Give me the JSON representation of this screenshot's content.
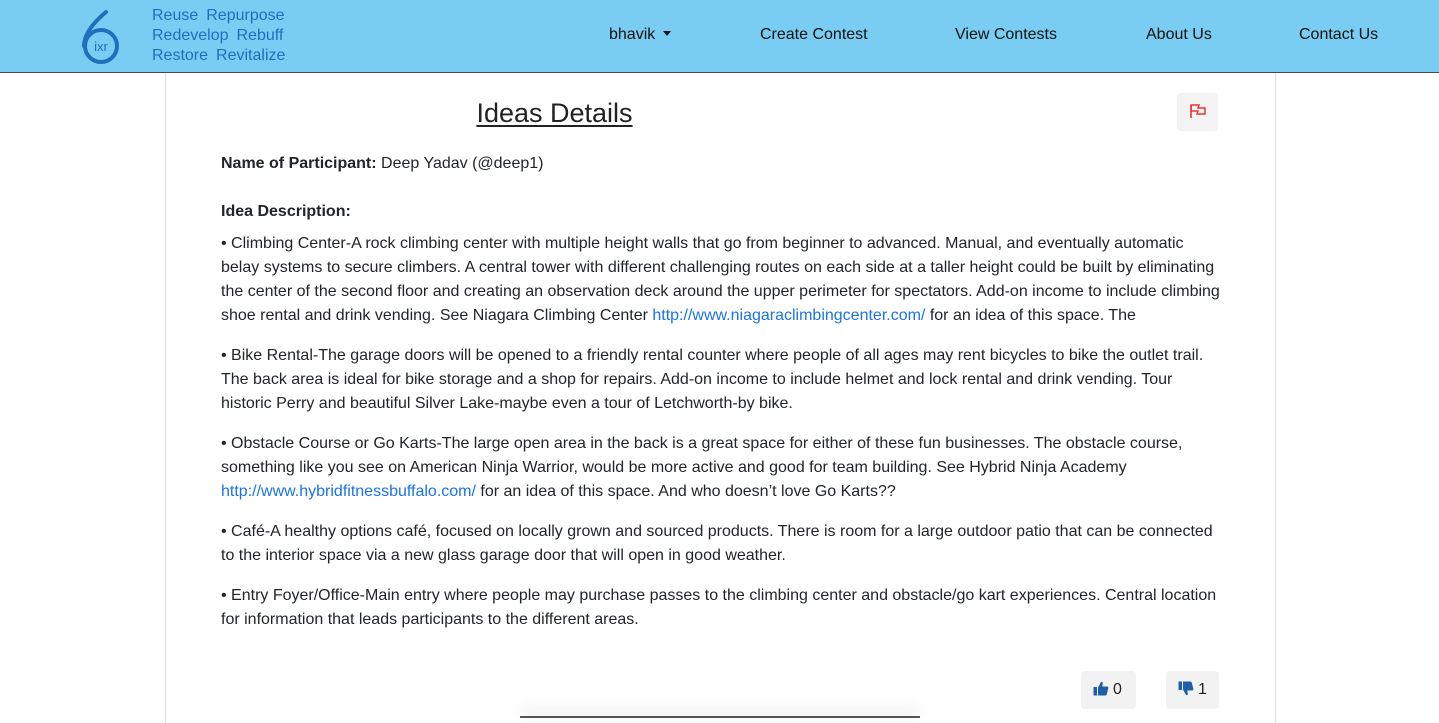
{
  "nav": {
    "tagline": [
      "Reuse",
      "Repurpose",
      "Redevelop",
      "Rebuff",
      "Restore",
      "Revitalize"
    ],
    "user_menu": "bhavik",
    "links": [
      "Create Contest",
      "View Contests",
      "About Us",
      "Contact Us"
    ],
    "logo_text": "ixr",
    "logo_digit": "6"
  },
  "page": {
    "title": "Ideas Details",
    "participant_label": "Name of Participant:",
    "participant_value": "Deep Yadav (@deep1)",
    "description_label": "Idea Description:"
  },
  "description": {
    "p1_text": "• Climbing Center-A rock climbing center with multiple height walls that go from beginner to advanced. Manual, and eventually automatic belay systems to secure climbers. A central tower with different challenging routes on each side at a taller height could be built by eliminating the center of the second floor and creating an observation deck around the upper perimeter for spectators. Add-on income to include climbing shoe rental and drink vending. See Niagara Climbing Center ",
    "p1_link": "http://www.niagaraclimbingcenter.com/",
    "p1_tail": " for an idea of this space. The",
    "p2": "• Bike Rental-The garage doors will be opened to a friendly rental counter where people of all ages may rent bicycles to bike the outlet trail. The back area is ideal for bike storage and a shop for repairs. Add-on income to include helmet and lock rental and drink vending. Tour historic Perry and beautiful Silver Lake-maybe even a tour of Letchworth-by bike.",
    "p3_text": "• Obstacle Course or Go Karts-The large open area in the back is a great space for either of these fun businesses. The obstacle course, something like you see on American Ninja Warrior, would be more active and good for team building. See Hybrid Ninja Academy ",
    "p3_link": "http://www.hybridfitnessbuffalo.com/",
    "p3_tail": " for an idea of this space. And who doesn’t love Go Karts??",
    "p4": "• Café-A healthy options café, focused on locally grown and sourced products. There is room for a large outdoor patio that can be connected to the interior space via a new glass garage door that will open in good weather.",
    "p5": "• Entry Foyer/Office-Main entry where people may purchase passes to the climbing center and obstacle/go kart experiences. Central location for information that leads participants to the different areas."
  },
  "votes": {
    "likes": "0",
    "dislikes": "1"
  },
  "colors": {
    "navbar": "#79cdf2",
    "tagline": "#1f6fbf",
    "link": "#1a73e8",
    "flag": "#e53935",
    "vote_icon": "#1f5fa8"
  },
  "icons": {
    "flag": "flag-icon",
    "like": "thumbs-up-icon",
    "dislike": "thumbs-down-icon"
  }
}
